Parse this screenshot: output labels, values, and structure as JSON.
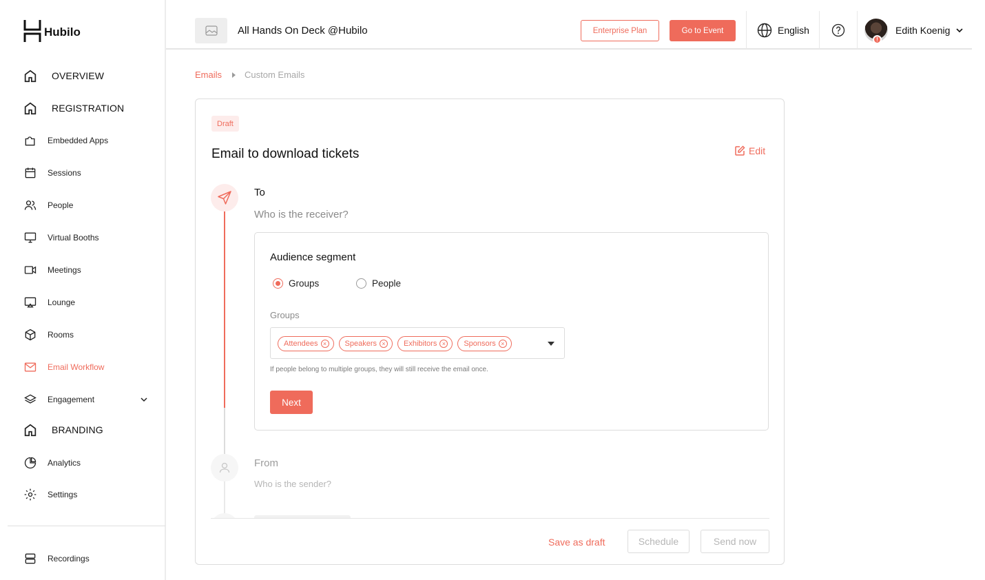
{
  "brand": {
    "name": "Hubilo"
  },
  "sidebar": {
    "items": [
      {
        "label": "OVERVIEW",
        "icon": "home-icon",
        "section": true,
        "active": false
      },
      {
        "label": "REGISTRATION",
        "icon": "home-icon",
        "section": true,
        "active": false
      },
      {
        "label": "Embedded Apps",
        "icon": "puzzle-icon",
        "section": false,
        "active": false
      },
      {
        "label": "Sessions",
        "icon": "calendar-icon",
        "section": false,
        "active": false
      },
      {
        "label": "People",
        "icon": "people-icon",
        "section": false,
        "active": false
      },
      {
        "label": "Virtual Booths",
        "icon": "monitor-icon",
        "section": false,
        "active": false
      },
      {
        "label": "Meetings",
        "icon": "video-icon",
        "section": false,
        "active": false
      },
      {
        "label": "Lounge",
        "icon": "lounge-icon",
        "section": false,
        "active": false
      },
      {
        "label": "Rooms",
        "icon": "cube-icon",
        "section": false,
        "active": false
      },
      {
        "label": "Email Workflow",
        "icon": "mail-icon",
        "section": false,
        "active": true
      },
      {
        "label": "Engagement",
        "icon": "layers-icon",
        "section": false,
        "active": false
      },
      {
        "label": "BRANDING",
        "icon": "home-icon",
        "section": true,
        "active": false
      },
      {
        "label": "Analytics",
        "icon": "pie-chart-icon",
        "section": false,
        "active": false
      },
      {
        "label": "Settings",
        "icon": "gear-icon",
        "section": false,
        "active": false
      },
      {
        "label": "Recordings",
        "icon": "server-icon",
        "section": false,
        "active": false
      }
    ]
  },
  "topbar": {
    "event_title": "All Hands On Deck @Hubilo",
    "enterprise_label": "Enterprise Plan",
    "go_event_label": "Go to Event",
    "language": "English",
    "user_name": "Edith Koenig",
    "avatar_badge": "!"
  },
  "breadcrumb": {
    "parent": "Emails",
    "current": "Custom Emails"
  },
  "email": {
    "status": "Draft",
    "title": "Email to download tickets",
    "edit_label": "Edit",
    "to": {
      "label": "To",
      "sub": "Who is the receiver?",
      "segment_title": "Audience segment",
      "radio_groups": "Groups",
      "radio_people": "People",
      "selected": "Groups",
      "groups_label": "Groups",
      "chips": [
        "Attendees",
        "Speakers",
        "Exhibitors",
        "Sponsors"
      ],
      "hint": "If people belong to multiple groups, they will still receive the email once.",
      "next_label": "Next"
    },
    "from": {
      "label": "From",
      "sub": "Who is the sender?"
    }
  },
  "footer": {
    "save_draft": "Save as draft",
    "schedule": "Schedule",
    "send_now": "Send now"
  },
  "colors": {
    "accent": "#ef6b5b",
    "accent_light": "#fdeceb"
  }
}
